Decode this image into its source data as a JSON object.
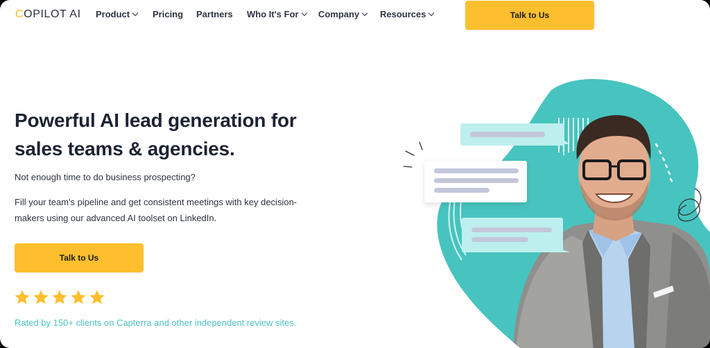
{
  "brand": {
    "logo_first_letter": "C",
    "logo_rest": "OPILOT AI",
    "accent_color": "#fdbf2d",
    "teal_color": "#4cc3c0"
  },
  "nav": {
    "items": [
      {
        "label": "Product",
        "has_dropdown": true
      },
      {
        "label": "Pricing",
        "has_dropdown": false
      },
      {
        "label": "Partners",
        "has_dropdown": false
      },
      {
        "label": "Who It's For",
        "has_dropdown": true
      },
      {
        "label": "Company",
        "has_dropdown": true
      },
      {
        "label": "Resources",
        "has_dropdown": true
      }
    ],
    "cta_label": "Talk to Us"
  },
  "hero": {
    "headline_line1": "Powerful AI lead generation for",
    "headline_line2": "sales teams & agencies.",
    "subheading": "Not enough time to do business prospecting?",
    "description": "Fill your team's pipeline and get consistent meetings with key decision-makers using our advanced AI toolset on LinkedIn.",
    "cta_label": "Talk to Us",
    "rating_stars": 5,
    "rating_text": "Rated by 150+ clients on Capterra and other independent review sites."
  },
  "illustration": {
    "icons": [
      "teal-blob",
      "chat-bubble",
      "chat-bubble",
      "chat-bubble",
      "person-photo",
      "scribble"
    ]
  }
}
